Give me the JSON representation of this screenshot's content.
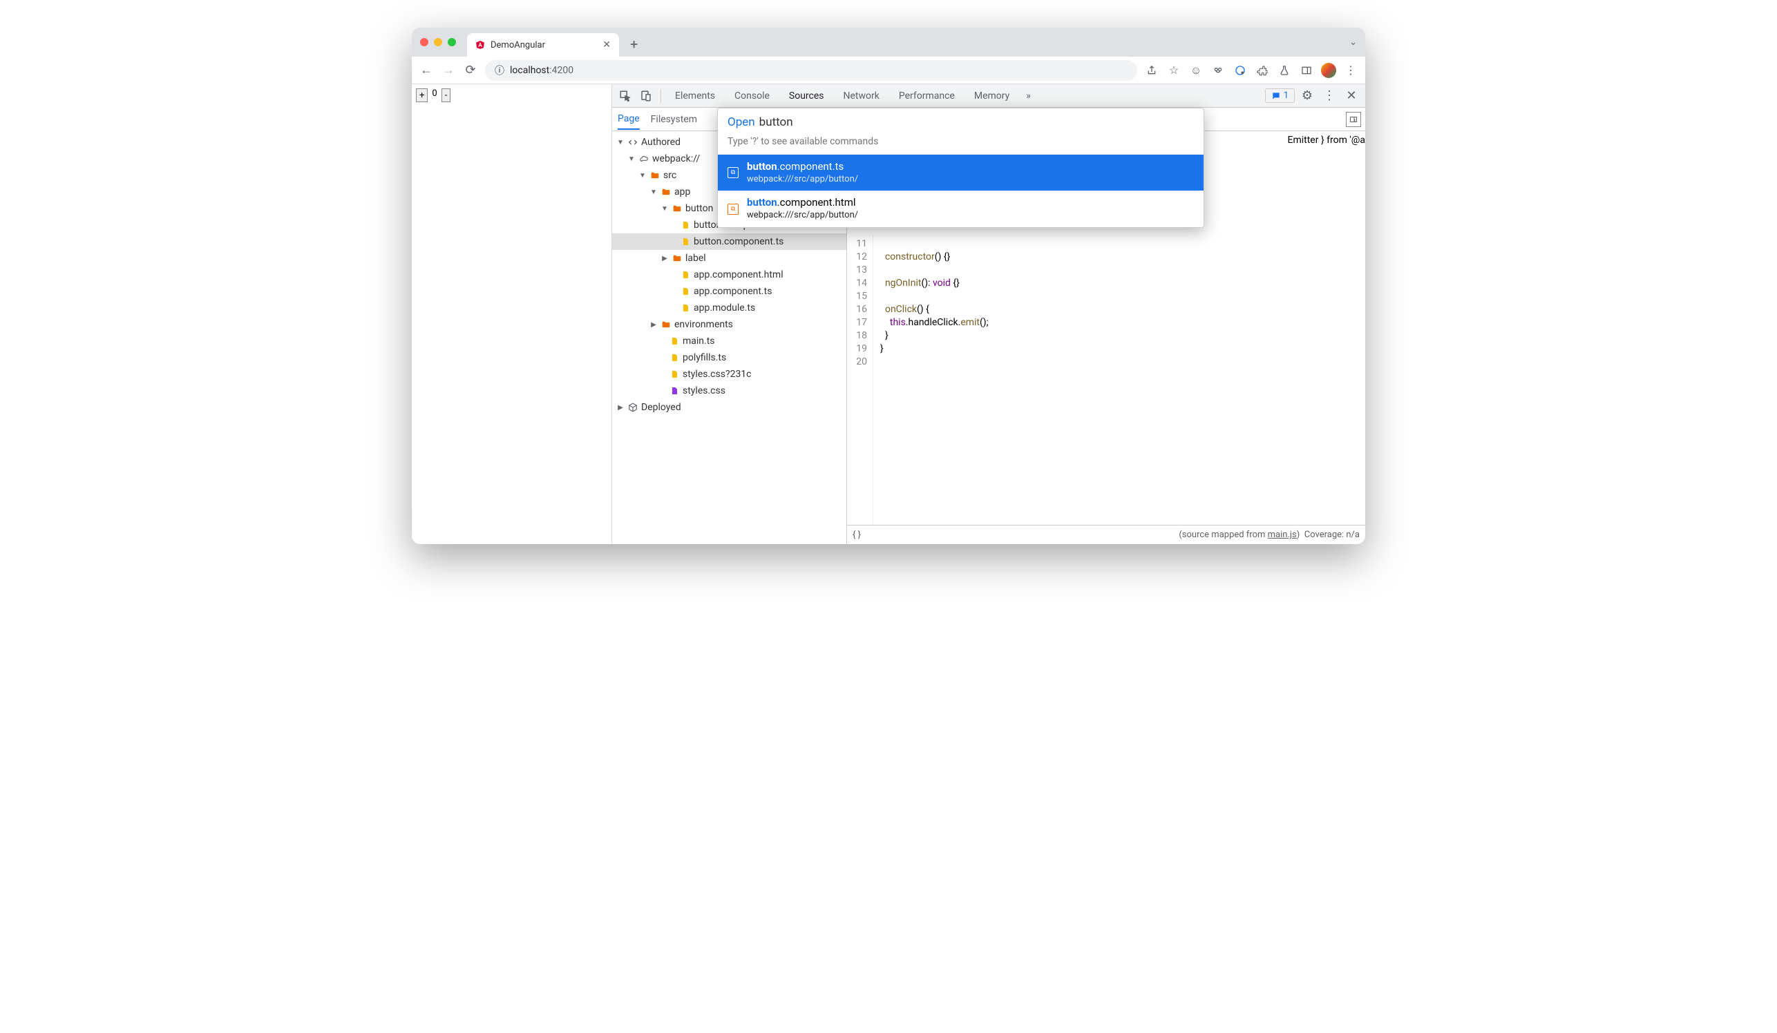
{
  "browser": {
    "tab_title": "DemoAngular",
    "url_host": "localhost",
    "url_port": ":4200"
  },
  "page_controls": {
    "plus": "+",
    "zero": "0",
    "minus": "-"
  },
  "devtools": {
    "tabs": [
      "Elements",
      "Console",
      "Sources",
      "Network",
      "Performance",
      "Memory"
    ],
    "active_tab": "Sources",
    "issues_count": "1"
  },
  "sources": {
    "subtabs": [
      "Page",
      "Filesystem"
    ],
    "active_subtab": "Page"
  },
  "tree": {
    "authored": "Authored",
    "webpack": "webpack://",
    "src": "src",
    "app": "app",
    "button_folder": "button",
    "button_html": "button.component.html",
    "button_ts": "button.component.ts",
    "label": "label",
    "app_html": "app.component.html",
    "app_ts": "app.component.ts",
    "app_module": "app.module.ts",
    "environments": "environments",
    "main": "main.ts",
    "polyfills": "polyfills.ts",
    "styles_q": "styles.css?231c",
    "styles": "styles.css",
    "deployed": "Deployed"
  },
  "palette": {
    "open_label": "Open",
    "query": "button",
    "hint": "Type '?' to see available commands",
    "items": [
      {
        "match": "button",
        "rest": ".component.ts",
        "path": "webpack:///src/app/button/",
        "selected": true
      },
      {
        "match": "button",
        "rest": ".component.html",
        "path": "webpack:///src/app/button/",
        "selected": false
      }
    ]
  },
  "code": {
    "visible_partial": "Emitter } from '@a",
    "lines": [
      {
        "n": 11,
        "t": ""
      },
      {
        "n": 12,
        "t": "  constructor() {}"
      },
      {
        "n": 13,
        "t": ""
      },
      {
        "n": 14,
        "t": "  ngOnInit(): void {}"
      },
      {
        "n": 15,
        "t": ""
      },
      {
        "n": 16,
        "t": "  onClick() {"
      },
      {
        "n": 17,
        "t": "    this.handleClick.emit();"
      },
      {
        "n": 18,
        "t": "  }"
      },
      {
        "n": 19,
        "t": "}"
      },
      {
        "n": 20,
        "t": ""
      }
    ]
  },
  "footer": {
    "mapped_prefix": "(source mapped from ",
    "mapped_link": "main.js",
    "mapped_suffix": ")",
    "coverage": "Coverage: n/a"
  }
}
